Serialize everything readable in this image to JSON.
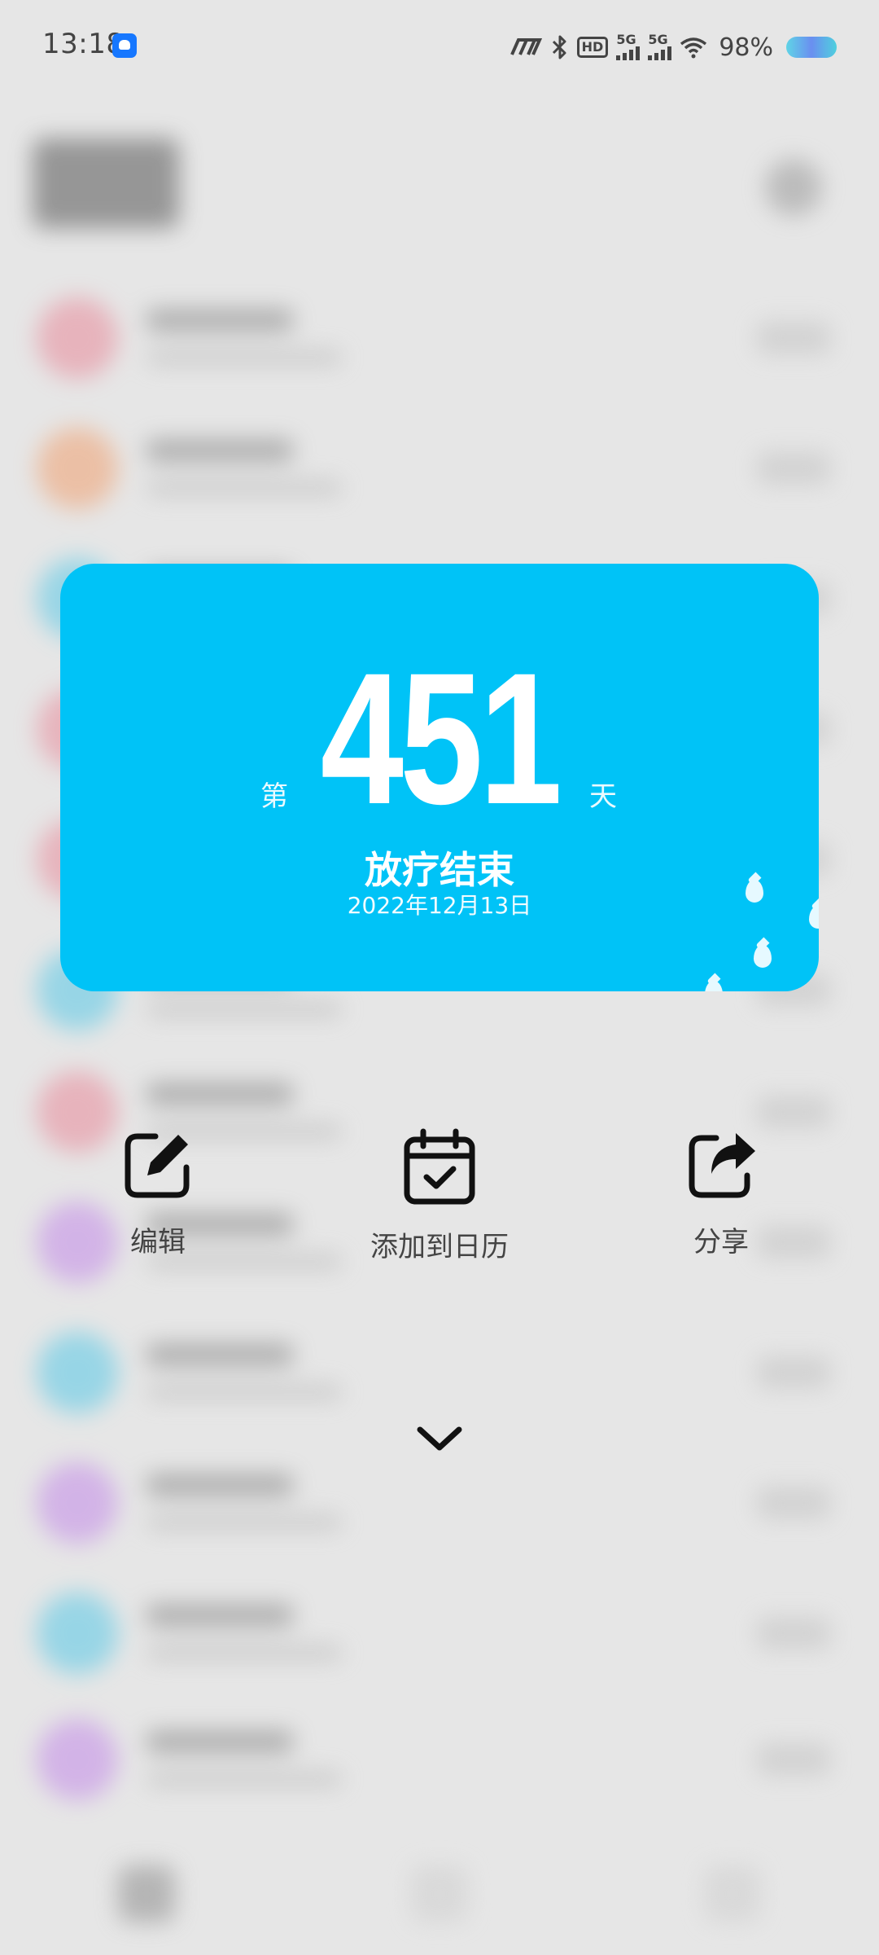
{
  "status_bar": {
    "time": "13:18",
    "network_1": "5G",
    "network_2": "5G",
    "hd_label": "HD",
    "battery_percent": "98%"
  },
  "card": {
    "background_color": "#00c3f7",
    "prefix": "第",
    "day_count": "451",
    "suffix": "天",
    "event_title": "放疗结束",
    "event_date": "2022年12月13日"
  },
  "actions": {
    "edit_label": "编辑",
    "add_calendar_label": "添加到日历",
    "share_label": "分享"
  },
  "icons": {
    "edit": "edit-icon",
    "calendar": "calendar-check-icon",
    "share": "share-icon",
    "collapse": "chevron-down-icon"
  }
}
